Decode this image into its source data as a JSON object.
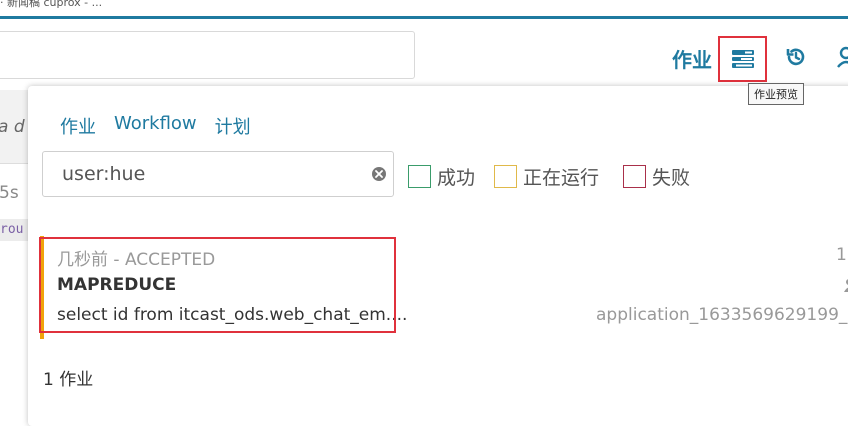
{
  "window": {
    "title_fragment": "· 新闻稿 cuprox - ..."
  },
  "header": {
    "jobs_label": "作业",
    "preview_tooltip": "作业预览"
  },
  "background": {
    "italic_fragment": "a d",
    "number_fragment": "5s",
    "code_fragment": "rou"
  },
  "panel": {
    "tabs": [
      {
        "label": "作业"
      },
      {
        "label": "Workflow"
      },
      {
        "label": "计划"
      }
    ],
    "filter": {
      "value": "user:hue",
      "placeholder": ""
    },
    "statuses": [
      {
        "label": "成功",
        "color": "#3a9c6b"
      },
      {
        "label": "正在运行",
        "color": "#e0b94a"
      },
      {
        "label": "失败",
        "color": "#a9304a"
      }
    ],
    "jobs": [
      {
        "meta": "几秒前 - ACCEPTED",
        "type": "MAPREDUCE",
        "query": "select id from itcast_ods.web_chat_em....",
        "right_value": "1",
        "application_id": "application_1633569629199_",
        "status_color": "#f0a30a"
      }
    ],
    "count_text": "1 作业"
  },
  "colors": {
    "accent": "#1f7aa0",
    "highlight": "#e0313c"
  }
}
